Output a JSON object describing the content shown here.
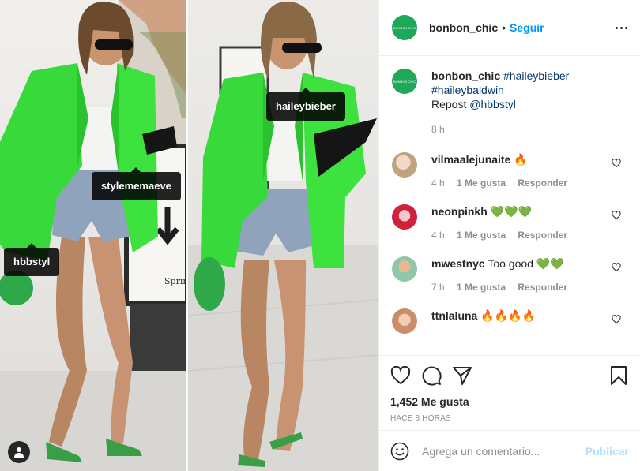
{
  "post": {
    "username": "bonbon_chic",
    "separator": "•",
    "follow_label": "Seguir",
    "avatar_text": "BONBON CHIC",
    "brand_color": "#1fa85a"
  },
  "photo": {
    "tags": [
      {
        "label": "stylememaeve"
      },
      {
        "label": "hbbstyl"
      },
      {
        "label": "haileybieber"
      }
    ]
  },
  "caption": {
    "username": "bonbon_chic",
    "hashtag1": "#haileybieber",
    "hashtag2": "#haileybaldwin",
    "text_prefix": "Repost ",
    "mention": "@hbbstyl",
    "time": "8 h"
  },
  "comments": [
    {
      "username": "vilmaalejunaite",
      "text": "🔥",
      "time": "4 h",
      "likes": "1 Me gusta",
      "reply": "Responder"
    },
    {
      "username": "neonpinkh",
      "text": "💚💚💚",
      "time": "4 h",
      "likes": "1 Me gusta",
      "reply": "Responder"
    },
    {
      "username": "mwestnyc",
      "text": "Too good 💚💚",
      "time": "7 h",
      "likes": "1 Me gusta",
      "reply": "Responder"
    },
    {
      "username": "ttnlaluna",
      "text": "🔥🔥🔥🔥",
      "time": "",
      "likes": "",
      "reply": ""
    }
  ],
  "actions": {
    "likes": "1,452 Me gusta",
    "timestamp": "HACE 8 HORAS"
  },
  "add_comment": {
    "placeholder": "Agrega un comentario...",
    "publish": "Publicar"
  }
}
